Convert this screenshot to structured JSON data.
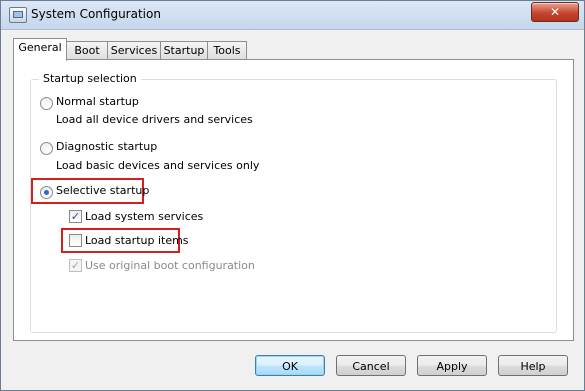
{
  "window": {
    "title": "System Configuration",
    "close_label": "✕"
  },
  "tabs": [
    {
      "label": "General",
      "active": true
    },
    {
      "label": "Boot"
    },
    {
      "label": "Services"
    },
    {
      "label": "Startup"
    },
    {
      "label": "Tools"
    }
  ],
  "startup_selection": {
    "title": "Startup selection",
    "normal": {
      "label": "Normal startup",
      "description": "Load all device drivers and services",
      "selected": false
    },
    "diagnostic": {
      "label": "Diagnostic startup",
      "description": "Load basic devices and services only",
      "selected": false
    },
    "selective": {
      "label": "Selective startup",
      "selected": true
    },
    "options": [
      {
        "label": "Load system services",
        "checked": true,
        "enabled": true
      },
      {
        "label": "Load startup items",
        "checked": false,
        "enabled": true
      },
      {
        "label": "Use original boot configuration",
        "checked": true,
        "enabled": false
      }
    ]
  },
  "buttons": {
    "ok": "OK",
    "cancel": "Cancel",
    "apply": "Apply",
    "help": "Help"
  },
  "colors": {
    "highlight": "#d21f1f",
    "titlebar": "#c6d7ec"
  }
}
